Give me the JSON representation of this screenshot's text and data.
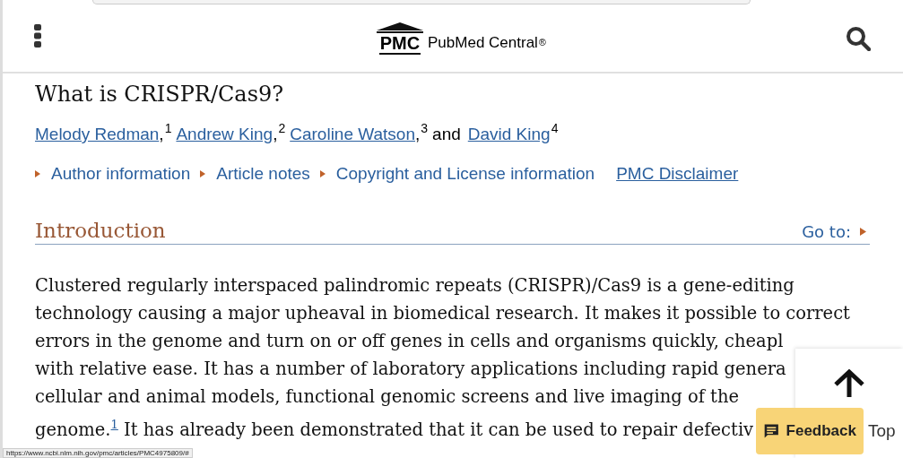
{
  "header": {
    "logo_mark": "PMC",
    "logo_text": "PubMed Central",
    "logo_reg": "®"
  },
  "article": {
    "title": "What is CRISPR/Cas9?",
    "authors": [
      {
        "name": "Melody Redman",
        "sup": "1",
        "sep": ","
      },
      {
        "name": "Andrew King",
        "sup": "2",
        "sep": ","
      },
      {
        "name": "Caroline Watson",
        "sup": "3",
        "sep": ",",
        "conj": "and"
      },
      {
        "name": "David King",
        "sup": "4"
      }
    ],
    "info_links": [
      {
        "label": "Author information",
        "kind": "toggle"
      },
      {
        "label": "Article notes",
        "kind": "toggle"
      },
      {
        "label": "Copyright and License information",
        "kind": "toggle"
      },
      {
        "label": "PMC Disclaimer",
        "kind": "link"
      }
    ],
    "section": {
      "heading": "Introduction",
      "goto": "Go to:"
    },
    "paragraph_lines": [
      "Clustered regularly interspaced palindromic repeats (CRISPR)/Cas9 is a gene-editing",
      "technology causing a major upheaval in biomedical research. It makes it possible to correct",
      "errors in the genome and turn on or off genes in cells and organisms quickly, cheapl",
      "with relative ease. It has a number of laboratory applications including rapid genera",
      "cellular and animal models, functional genomic screens and live imaging of the",
      "genome.$^{1}$ It has already been demonstrated that it can be used to repair defectiv"
    ]
  },
  "overlay": {
    "top_label": "Top",
    "feedback": "Feedback"
  },
  "status_url": "https://www.ncbi.nlm.nih.gov/pmc/articles/PMC4975809/#"
}
